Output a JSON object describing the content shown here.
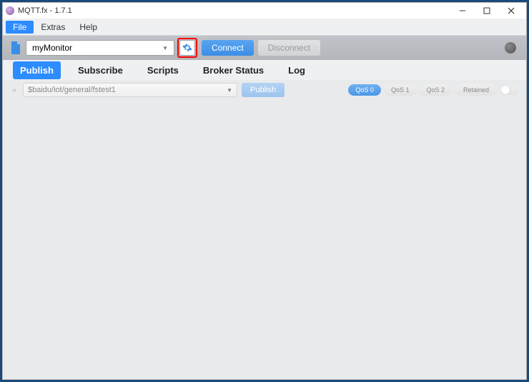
{
  "window": {
    "title": "MQTT.fx - 1.7.1"
  },
  "menubar": {
    "file": "File",
    "extras": "Extras",
    "help": "Help"
  },
  "connection": {
    "profile": "myMonitor",
    "connect_label": "Connect",
    "disconnect_label": "Disconnect"
  },
  "tabs": {
    "publish": "Publish",
    "subscribe": "Subscribe",
    "scripts": "Scripts",
    "broker_status": "Broker Status",
    "log": "Log"
  },
  "publish": {
    "topic": "$baidu/iot/general/fstest1",
    "publish_label": "Publish",
    "qos0": "QoS 0",
    "qos1": "QoS 1",
    "qos2": "QoS 2",
    "retained": "Retained"
  }
}
